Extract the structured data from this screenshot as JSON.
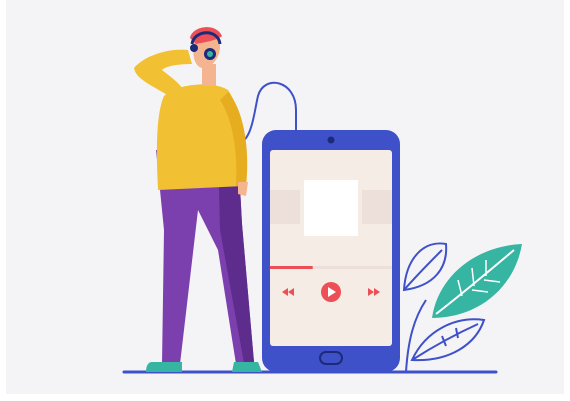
{
  "illustration": {
    "subject": "person-listening-to-music-with-phone",
    "colors": {
      "background": "#f4f4f6",
      "frame": "#ffffff",
      "phone_body": "#3f51c9",
      "phone_screen": "#f6ece6",
      "screen_blocks": "#ede0da",
      "accent": "#ec4f55",
      "shirt": "#f2c033",
      "pants": "#7c3fae",
      "leaf": "#35b5a2",
      "line_art": "#3f51c9",
      "skin": "#f4b48f",
      "ground": "#3f51c9"
    },
    "player": {
      "progress": 0.35,
      "controls": [
        "rewind-icon",
        "play-icon",
        "fast-forward-icon"
      ]
    }
  }
}
